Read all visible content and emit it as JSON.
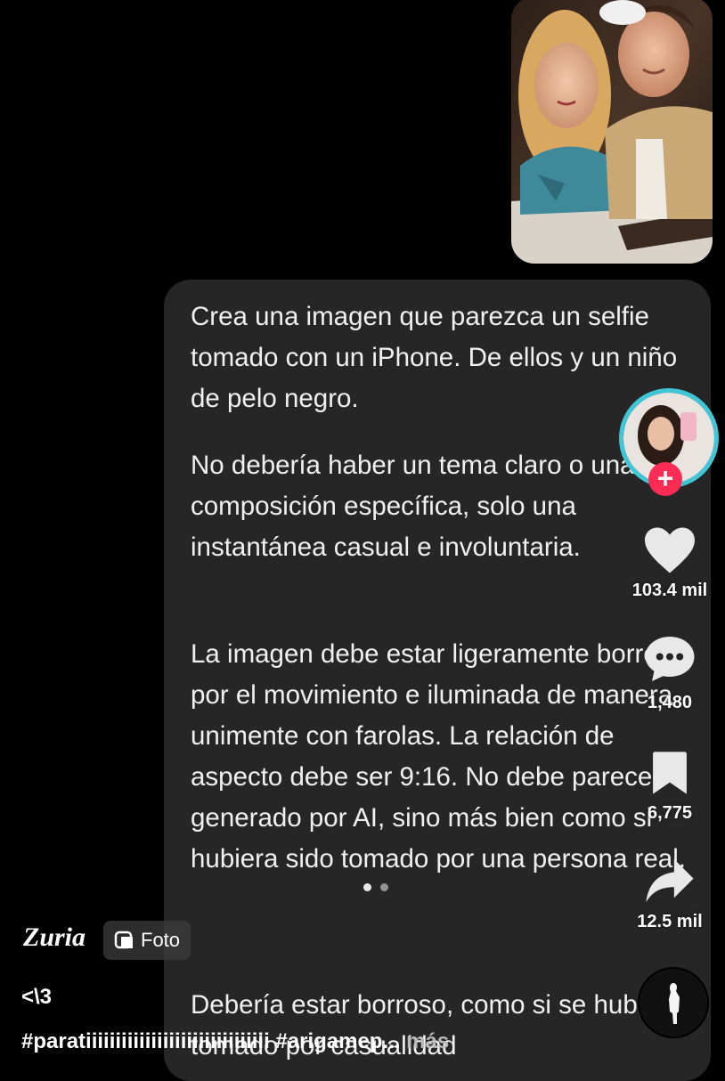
{
  "post": {
    "paragraphs": [
      "Crea una imagen que parezca un selfie tomado con un iPhone. De ellos y un niño de pelo negro.",
      "No debería haber un tema claro o una composición específica, solo una instantánea casual e involuntaria.",
      "La imagen debe estar ligeramente borrosa por el movimiento e iluminada de manera unimente con farolas. La relación de aspecto debe ser 9:16. No debe parecer generado por AI, sino más bien como si hubiera sido tomado por una persona real.",
      "Debería estar borroso, como si se hubiera tomado por casualidad"
    ]
  },
  "actions": {
    "likes": "103.4 mil",
    "comments": "1,480",
    "saves": "6,775",
    "shares": "12.5 mil"
  },
  "author": {
    "name": "Zuria",
    "tag_label": "Foto"
  },
  "caption": {
    "line1": "<\\3",
    "line2": "#paratiiiiiiiiiiiiiiiiiiiiiiiiiiiiiii #arigamep...",
    "more": "más"
  },
  "colors": {
    "background": "#000000",
    "bubble": "#262626",
    "ring": "#3fc7d8",
    "follow": "#fe2c55"
  },
  "icons": [
    "heart-icon",
    "comment-icon",
    "bookmark-icon",
    "share-icon",
    "photo-tag-icon",
    "plus-icon",
    "music-disc-icon"
  ]
}
